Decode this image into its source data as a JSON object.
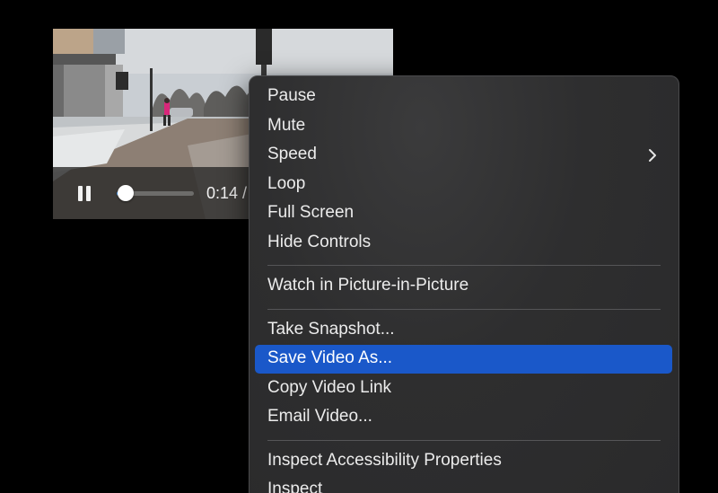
{
  "video_player": {
    "time_display": "0:14 /",
    "progress_fraction": 0.12,
    "state": "playing"
  },
  "context_menu": {
    "groups": [
      [
        {
          "label": "Pause"
        },
        {
          "label": "Mute"
        },
        {
          "label": "Speed",
          "submenu": true
        },
        {
          "label": "Loop"
        },
        {
          "label": "Full Screen"
        },
        {
          "label": "Hide Controls"
        }
      ],
      [
        {
          "label": "Watch in Picture-in-Picture"
        }
      ],
      [
        {
          "label": "Take Snapshot..."
        },
        {
          "label": "Save Video As...",
          "highlighted": true
        },
        {
          "label": "Copy Video Link"
        },
        {
          "label": "Email Video..."
        }
      ],
      [
        {
          "label": "Inspect Accessibility Properties"
        },
        {
          "label": "Inspect"
        }
      ]
    ]
  },
  "colors": {
    "menu_highlight": "#1a58c9",
    "menu_background": "#2e2e2f",
    "scrubber_fill": "#4aa3ff"
  }
}
